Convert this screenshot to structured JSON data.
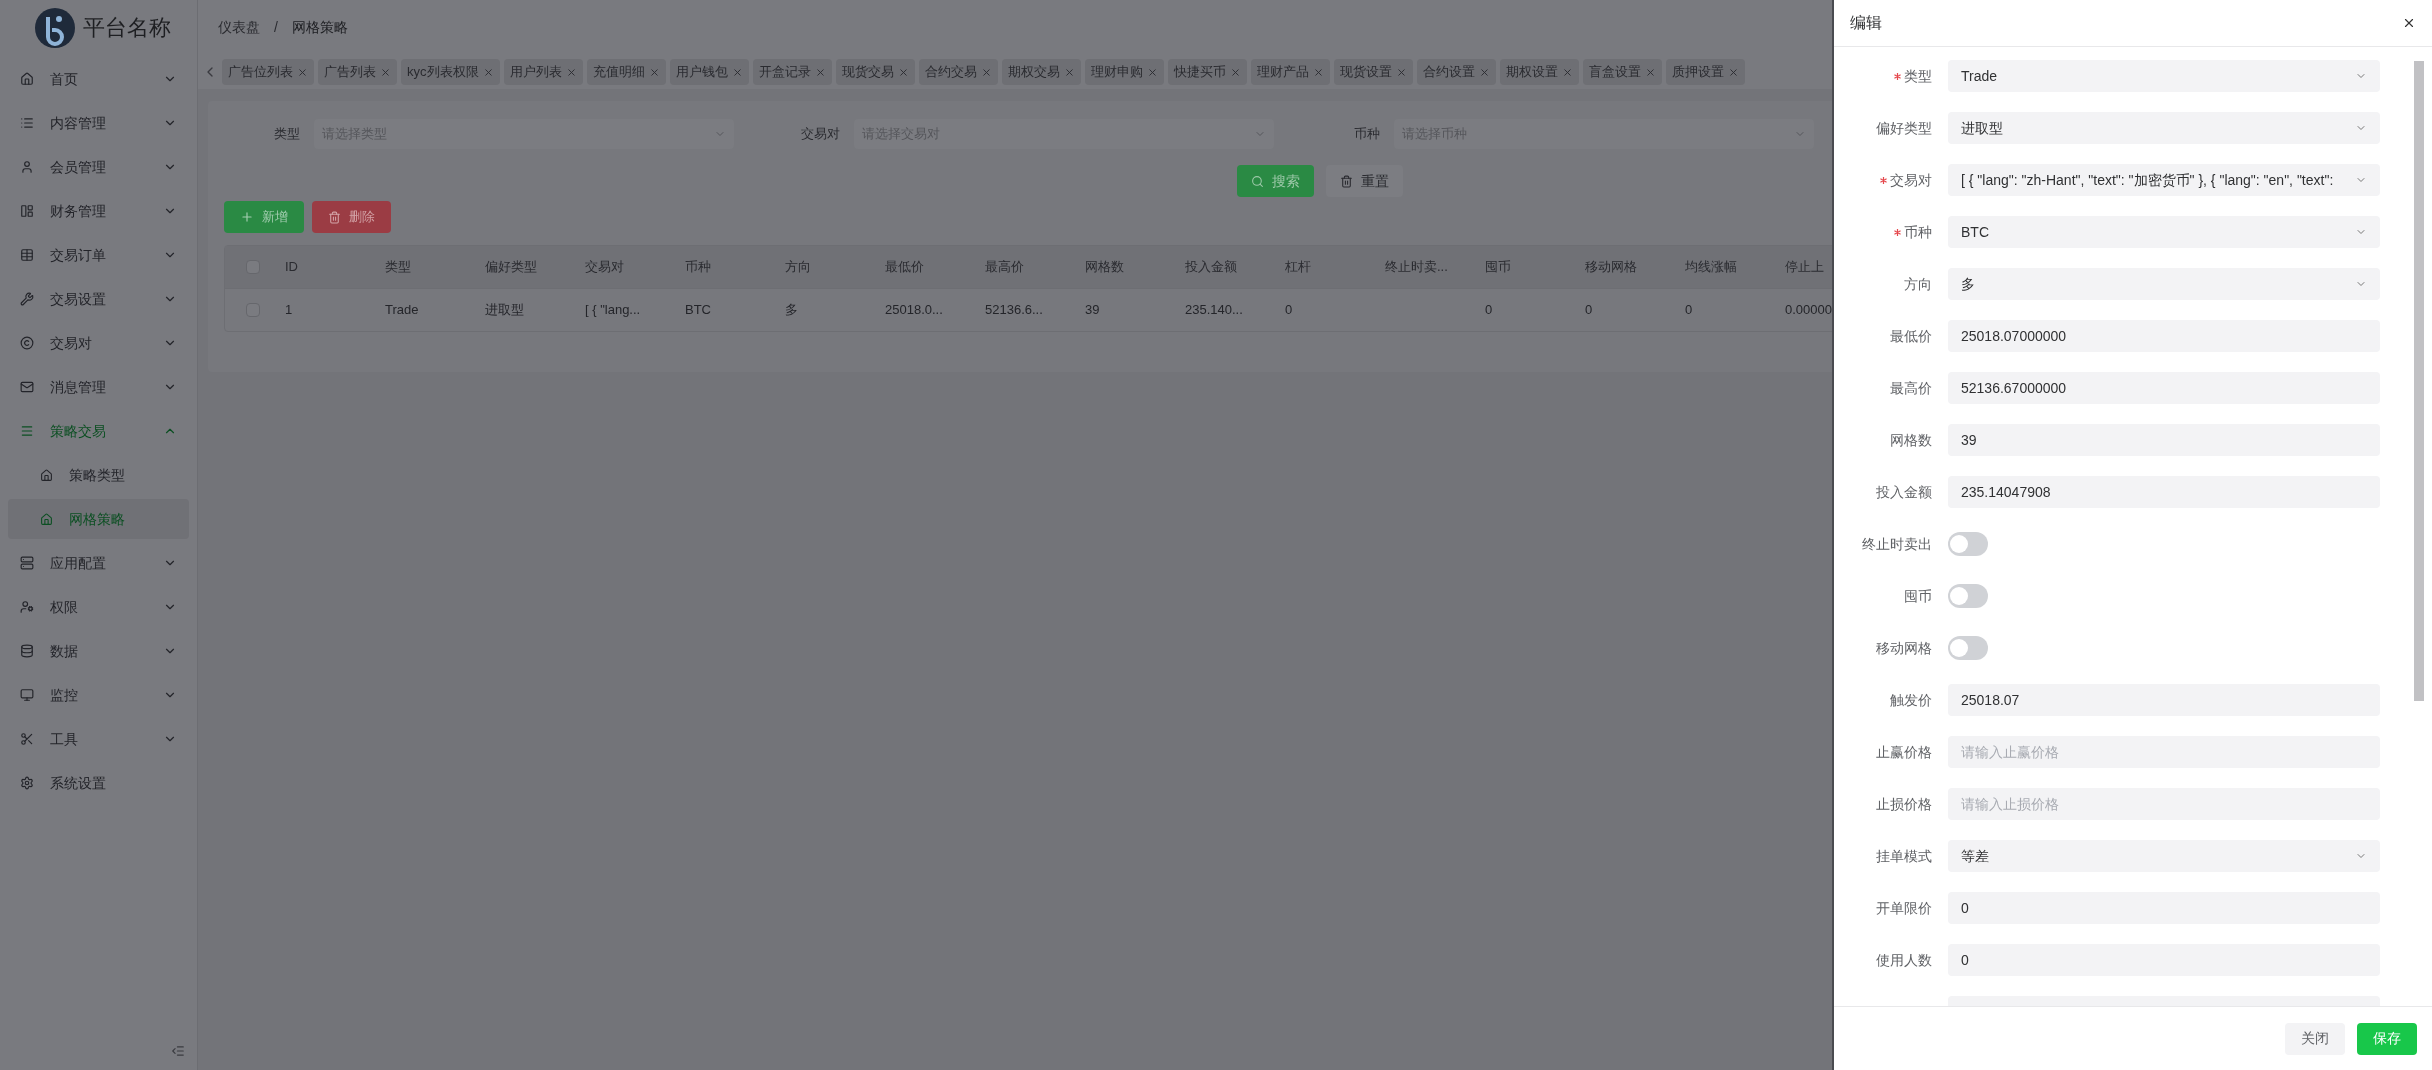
{
  "header": {
    "platform_name": "平台名称",
    "breadcrumb": [
      "仪表盘",
      "网格策略"
    ],
    "separator": "/"
  },
  "sidebar": {
    "items": [
      {
        "label": "首页",
        "expanded": false
      },
      {
        "label": "内容管理",
        "expanded": false
      },
      {
        "label": "会员管理",
        "expanded": false
      },
      {
        "label": "财务管理",
        "expanded": false
      },
      {
        "label": "交易订单",
        "expanded": false
      },
      {
        "label": "交易设置",
        "expanded": false
      },
      {
        "label": "交易对",
        "expanded": false
      },
      {
        "label": "消息管理",
        "expanded": false
      },
      {
        "label": "策略交易",
        "expanded": true,
        "children": [
          {
            "label": "策略类型",
            "selected": false
          },
          {
            "label": "网格策略",
            "selected": true
          }
        ]
      },
      {
        "label": "应用配置",
        "expanded": false
      },
      {
        "label": "权限",
        "expanded": false
      },
      {
        "label": "数据",
        "expanded": false
      },
      {
        "label": "监控",
        "expanded": false
      },
      {
        "label": "工具",
        "expanded": false
      },
      {
        "label": "系统设置"
      }
    ]
  },
  "tabs": [
    "广告位列表",
    "广告列表",
    "kyc列表权限",
    "用户列表",
    "充值明细",
    "用户钱包",
    "开盒记录",
    "现货交易",
    "合约交易",
    "期权交易",
    "理财申购",
    "快捷买币",
    "理财产品",
    "现货设置",
    "合约设置",
    "期权设置",
    "盲盒设置",
    "质押设置"
  ],
  "filters": [
    {
      "label": "类型",
      "placeholder": "请选择类型"
    },
    {
      "label": "交易对",
      "placeholder": "请选择交易对"
    },
    {
      "label": "币种",
      "placeholder": "请选择币种"
    }
  ],
  "filter_buttons": {
    "search": "搜索",
    "reset": "重置"
  },
  "actions": {
    "add": "新增",
    "delete": "删除"
  },
  "table": {
    "header_checked": false,
    "columns": [
      "ID",
      "类型",
      "偏好类型",
      "交易对",
      "币种",
      "方向",
      "最低价",
      "最高价",
      "网格数",
      "投入金额",
      "杠杆",
      "终止时卖...",
      "囤币",
      "移动网格",
      "均线涨幅",
      "停止上"
    ],
    "rows": [
      {
        "checked": false,
        "cells": [
          "1",
          "Trade",
          "进取型",
          "[ { \"lang...",
          "BTC",
          "多",
          "25018.0...",
          "52136.6...",
          "39",
          "235.140...",
          "0",
          "",
          "0",
          "0",
          "0",
          "0.00000"
        ]
      }
    ]
  },
  "drawer": {
    "title": "编辑",
    "fields": [
      {
        "kind": "select",
        "label": "类型",
        "required": true,
        "value": "Trade"
      },
      {
        "kind": "select",
        "label": "偏好类型",
        "required": false,
        "value": "进取型"
      },
      {
        "kind": "select",
        "label": "交易对",
        "required": true,
        "value": "[ { \"lang\": \"zh-Hant\", \"text\": \"加密货币\" }, { \"lang\": \"en\", \"text\":"
      },
      {
        "kind": "select",
        "label": "币种",
        "required": true,
        "value": "BTC"
      },
      {
        "kind": "select",
        "label": "方向",
        "required": false,
        "value": "多"
      },
      {
        "kind": "input",
        "label": "最低价",
        "required": false,
        "value": "25018.07000000"
      },
      {
        "kind": "input",
        "label": "最高价",
        "required": false,
        "value": "52136.67000000"
      },
      {
        "kind": "input",
        "label": "网格数",
        "required": false,
        "value": "39"
      },
      {
        "kind": "input",
        "label": "投入金额",
        "required": false,
        "value": "235.14047908"
      },
      {
        "kind": "switch",
        "label": "终止时卖出",
        "required": false,
        "on": false
      },
      {
        "kind": "switch",
        "label": "囤币",
        "required": false,
        "on": false
      },
      {
        "kind": "switch",
        "label": "移动网格",
        "required": false,
        "on": false
      },
      {
        "kind": "input",
        "label": "触发价",
        "required": false,
        "value": "25018.07"
      },
      {
        "kind": "input",
        "label": "止赢价格",
        "required": false,
        "placeholder": "请输入止赢价格"
      },
      {
        "kind": "input",
        "label": "止损价格",
        "required": false,
        "placeholder": "请输入止损价格"
      },
      {
        "kind": "select",
        "label": "挂单模式",
        "required": false,
        "value": "等差"
      },
      {
        "kind": "input",
        "label": "开单限价",
        "required": false,
        "value": "0"
      },
      {
        "kind": "input",
        "label": "使用人数",
        "required": false,
        "value": "0"
      }
    ],
    "buttons": {
      "close": "关闭",
      "save": "保存"
    }
  }
}
